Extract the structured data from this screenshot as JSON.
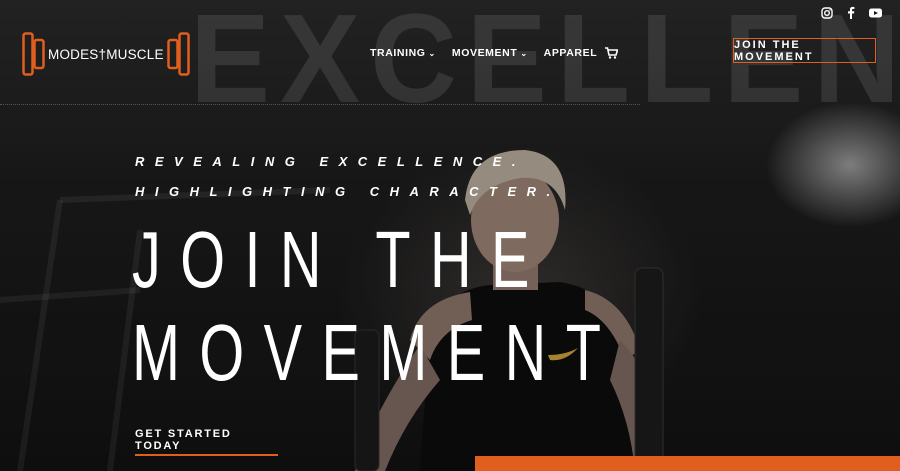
{
  "brand": {
    "logo_text": "MODES†MUSCLE",
    "accent": "#e05f1e"
  },
  "background_word": "EXCELLENCE",
  "nav": {
    "items": [
      {
        "label": "TRAINING",
        "has_dropdown": true
      },
      {
        "label": "MOVEMENT",
        "has_dropdown": true
      },
      {
        "label": "APPAREL",
        "has_dropdown": false
      }
    ],
    "cart_icon": "shopping-cart-icon"
  },
  "header_cta": "JOIN THE MOVEMENT",
  "social": [
    "instagram-icon",
    "facebook-icon",
    "youtube-icon"
  ],
  "hero": {
    "tagline": "REVEALING EXCELLENCE. HIGHLIGHTING CHARACTER.",
    "headline_line1": "JOIN THE",
    "headline_line2": "MOVEMENT",
    "cta": "GET STARTED TODAY"
  }
}
